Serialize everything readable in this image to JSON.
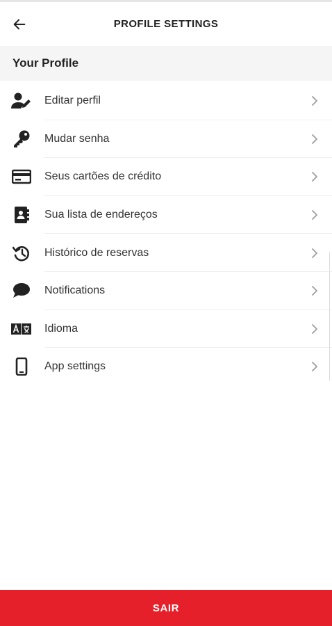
{
  "header": {
    "title": "PROFILE SETTINGS",
    "back_icon": "arrow-left-icon"
  },
  "section": {
    "title": "Your Profile"
  },
  "menu": {
    "items": [
      {
        "label": "Editar perfil",
        "icon": "user-edit-icon"
      },
      {
        "label": "Mudar senha",
        "icon": "key-icon"
      },
      {
        "label": "Seus cartões de crédito",
        "icon": "credit-card-icon"
      },
      {
        "label": "Sua lista de endereços",
        "icon": "address-book-icon"
      },
      {
        "label": "Histórico de reservas",
        "icon": "history-icon"
      },
      {
        "label": "Notifications",
        "icon": "chat-bubble-icon"
      },
      {
        "label": "Idioma",
        "icon": "translate-icon"
      },
      {
        "label": "App settings",
        "icon": "smartphone-icon"
      }
    ]
  },
  "footer": {
    "logout_label": "SAIR"
  },
  "colors": {
    "accent": "#e5202b",
    "section_bg": "#f5f5f5",
    "text": "#333333"
  }
}
